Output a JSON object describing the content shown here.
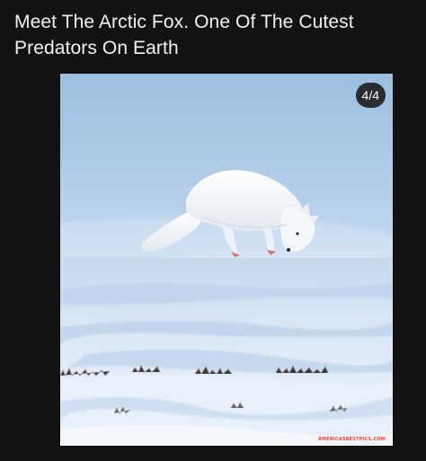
{
  "post": {
    "title": "Meet The Arctic Fox. One Of The Cutest Predators On Earth"
  },
  "gallery": {
    "counter": "4/4"
  },
  "watermark": {
    "text": "AMERICASBESTPICS.COM"
  },
  "colors": {
    "background": "#121212",
    "title_text": "#f2f2f2",
    "sky": "#a9c7e4",
    "snow": "#e4eef9",
    "watermark": "#ff3b30"
  }
}
